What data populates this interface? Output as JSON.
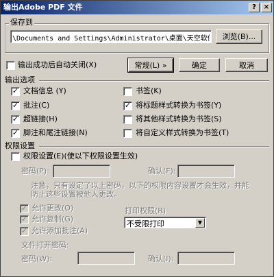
{
  "window": {
    "title": "输出Adobe PDF 文件",
    "help_glyph": "?",
    "close_glyph": "×"
  },
  "save_to": {
    "group_label": "保存到",
    "path": "\\Documents and Settings\\Administrator\\桌面\\天空软件站.pdf",
    "browse_label": "浏览(B)..."
  },
  "top": {
    "auto_close_label": "输出成功后自动关闭(X)",
    "auto_close_checked": false,
    "normal_label": "常规(L)",
    "normal_arrow": "»",
    "ok_label": "确定",
    "cancel_label": "取消"
  },
  "output_options": {
    "header": "输出选项",
    "left": [
      {
        "label": "文档信息 (Y)",
        "checked": true
      },
      {
        "label": "批注(C)",
        "checked": true
      },
      {
        "label": "超链接(H)",
        "checked": true
      },
      {
        "label": "脚注和尾注链接(N)",
        "checked": true
      }
    ],
    "right": [
      {
        "label": "书签(K)",
        "checked": false
      },
      {
        "label": "将标题样式转换为书签(Y)",
        "checked": true
      },
      {
        "label": "将其他样式转换为书签(S)",
        "checked": false
      },
      {
        "label": "将自定义样式转换为书签(T)",
        "checked": false
      }
    ]
  },
  "permissions": {
    "header": "权限设置",
    "enable_label": "权限设置(E)(使以下权限设置生效)",
    "enable_checked": false,
    "password_label": "密码(P):",
    "confirm_label": "确认(F):",
    "note_line1": "注意，只有设定了以上密码，以下的权限内容设置才会生效，并能",
    "note_line2": "防止这些设置被他人更改。",
    "allow_change": "允许更改(O)",
    "allow_copy": "允许复制(G)",
    "allow_comment": "允许添加批注(A)",
    "print_label": "打印权限(R)",
    "print_value": "不受限打印",
    "dropdown_glyph": "▼",
    "open_password_label": "文件打开密码:",
    "open_pwd_label": "密码(W):",
    "open_confirm_label": "确认(I):",
    "check_glyph": "✓"
  }
}
